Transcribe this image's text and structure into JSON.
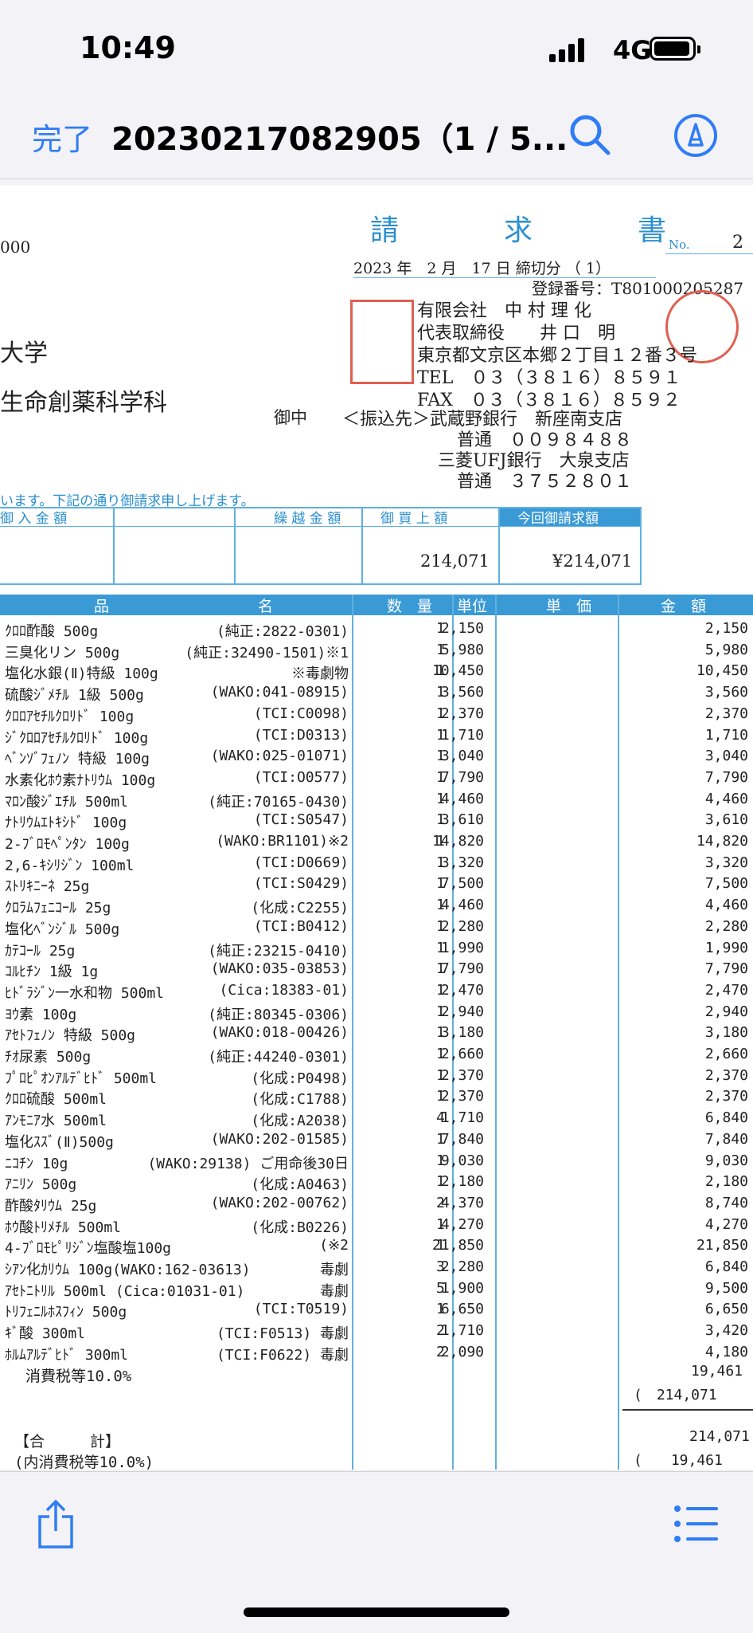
{
  "status": {
    "time": "10:49",
    "network": "4G"
  },
  "nav": {
    "done": "完了",
    "title": "20230217082905（1 / 5..."
  },
  "doc": {
    "title": "請　求　書",
    "no_label": "No.",
    "no_value": "2",
    "left_fragment_1": "000",
    "left_fragment_2": "大学",
    "left_fragment_3": "生命創薬科学科",
    "onchu": "御中",
    "date": "2023 年　2 月　17 日 締切分 （ 1）",
    "reg_no": "登録番号：T801000205287",
    "company": "有限会社　中 村 理 化",
    "rep": "代表取締役　　井 口　明",
    "address": "東京都文京区本郷２丁目１２番３号",
    "tel": "TEL　０３（３８１６）８５９１",
    "fax": "FAX　０３（３８１６）８５９２",
    "bank1": "＜振込先＞武蔵野銀行　新座南支店",
    "bank1_acct": "普通　００９８４８８",
    "bank2": "三菱UFJ銀行　大泉支店",
    "bank2_acct": "普通　３７５２８０１",
    "notice": "います。下記の通り御請求申し上げます。",
    "summary_headers": [
      "御 入 金 額",
      "繰 越 金 額",
      "御 買 上 額",
      "今回御請求額"
    ],
    "summary_purchase": "214,071",
    "summary_billed": "¥214,071"
  },
  "table": {
    "headers": {
      "item": "品",
      "name": "名",
      "qty": "数　量",
      "unit": "単位",
      "price": "単　価",
      "amount": "金　額"
    },
    "rows": [
      {
        "name": "ｸﾛﾛ酢酸 500g",
        "note": "(純正:2822-0301)",
        "qty": "1",
        "price": "2,150",
        "amount": "2,150"
      },
      {
        "name": "三臭化リン 500g",
        "note": "(純正:32490-1501)※1",
        "qty": "1",
        "price": "5,980",
        "amount": "5,980"
      },
      {
        "name": "塩化水銀(Ⅱ)特級 100g",
        "note": "※毒劇物",
        "qty": "1",
        "price": "10,450",
        "amount": "10,450"
      },
      {
        "name": "硫酸ｼﾞﾒﾁﾙ 1級 500g",
        "note": "(WAKO:041-08915)",
        "qty": "1",
        "price": "3,560",
        "amount": "3,560"
      },
      {
        "name": "ｸﾛﾛｱｾﾁﾙｸﾛﾘﾄﾞ 100g",
        "note": "(TCI:C0098)",
        "qty": "1",
        "price": "2,370",
        "amount": "2,370"
      },
      {
        "name": "ｼﾞｸﾛﾛｱｾﾁﾙｸﾛﾘﾄﾞ 100g",
        "note": "(TCI:D0313)",
        "qty": "1",
        "price": "1,710",
        "amount": "1,710"
      },
      {
        "name": "ﾍﾞﾝｿﾞﾌｪﾉﾝ 特級 100g",
        "note": "(WAKO:025-01071)",
        "qty": "1",
        "price": "3,040",
        "amount": "3,040"
      },
      {
        "name": "水素化ﾎｳ素ﾅﾄﾘｳﾑ 100g",
        "note": "(TCI:O0577)",
        "qty": "1",
        "price": "7,790",
        "amount": "7,790"
      },
      {
        "name": "ﾏﾛﾝ酸ｼﾞｴﾁﾙ 500ml",
        "note": "(純正:70165-0430)",
        "qty": "1",
        "price": "4,460",
        "amount": "4,460"
      },
      {
        "name": "ﾅﾄﾘｳﾑｴﾄｷｼﾄﾞ 100g",
        "note": "(TCI:S0547)",
        "qty": "1",
        "price": "3,610",
        "amount": "3,610"
      },
      {
        "name": "2-ﾌﾞﾛﾓﾍﾟﾝﾀﾝ 100g",
        "note": "(WAKO:BR1101)※2",
        "qty": "1",
        "price": "14,820",
        "amount": "14,820"
      },
      {
        "name": "2,6-ｷｼﾘｼﾞﾝ 100ml",
        "note": "(TCI:D0669)",
        "qty": "1",
        "price": "3,320",
        "amount": "3,320"
      },
      {
        "name": "ｽﾄﾘｷﾆｰﾈ 25g",
        "note": "(TCI:S0429)",
        "qty": "1",
        "price": "7,500",
        "amount": "7,500"
      },
      {
        "name": "ｸﾛﾗﾑﾌｪﾆｺｰﾙ 25g",
        "note": "(化成:C2255)",
        "qty": "1",
        "price": "4,460",
        "amount": "4,460"
      },
      {
        "name": "塩化ﾍﾞﾝｼﾞﾙ 500g",
        "note": "(TCI:B0412)",
        "qty": "1",
        "price": "2,280",
        "amount": "2,280"
      },
      {
        "name": "ｶﾃｺｰﾙ 25g",
        "note": "(純正:23215-0410)",
        "qty": "1",
        "price": "1,990",
        "amount": "1,990"
      },
      {
        "name": "ｺﾙﾋﾁﾝ 1級 1g",
        "note": "(WAKO:035-03853)",
        "qty": "1",
        "price": "7,790",
        "amount": "7,790"
      },
      {
        "name": "ﾋﾄﾞﾗｼﾞﾝ一水和物 500ml",
        "note": "(Cica:18383-01)",
        "qty": "1",
        "price": "2,470",
        "amount": "2,470"
      },
      {
        "name": "ﾖｳ素 100g",
        "note": "(純正:80345-0306)",
        "qty": "1",
        "price": "2,940",
        "amount": "2,940"
      },
      {
        "name": "ｱｾﾄﾌｪﾉﾝ 特級 500g",
        "note": "(WAKO:018-00426)",
        "qty": "1",
        "price": "3,180",
        "amount": "3,180"
      },
      {
        "name": "ﾁｵ尿素 500g",
        "note": "(純正:44240-0301)",
        "qty": "1",
        "price": "2,660",
        "amount": "2,660"
      },
      {
        "name": "ﾌﾟﾛﾋﾟｵﾝｱﾙﾃﾞﾋﾄﾞ 500ml",
        "note": "(化成:P0498)",
        "qty": "1",
        "price": "2,370",
        "amount": "2,370"
      },
      {
        "name": "ｸﾛﾛ硫酸 500ml",
        "note": "(化成:C1788)",
        "qty": "1",
        "price": "2,370",
        "amount": "2,370"
      },
      {
        "name": "ｱﾝﾓﾆｱ水 500ml",
        "note": "(化成:A2038)",
        "qty": "4",
        "price": "1,710",
        "amount": "6,840"
      },
      {
        "name": "塩化ｽｽﾞ(Ⅱ)500g",
        "note": "(WAKO:202-01585)",
        "qty": "1",
        "price": "7,840",
        "amount": "7,840"
      },
      {
        "name": "ﾆｺﾁﾝ 10g",
        "note": "(WAKO:29138) ご用命後30日",
        "qty": "1",
        "price": "9,030",
        "amount": "9,030"
      },
      {
        "name": "ｱﾆﾘﾝ 500g",
        "note": "(化成:A0463)",
        "qty": "1",
        "price": "2,180",
        "amount": "2,180"
      },
      {
        "name": "酢酸ﾀﾘｳﾑ 25g",
        "note": "(WAKO:202-00762)",
        "qty": "2",
        "price": "4,370",
        "amount": "8,740"
      },
      {
        "name": "ﾎｳ酸ﾄﾘﾒﾁﾙ 500ml",
        "note": "(化成:B0226)",
        "qty": "1",
        "price": "4,270",
        "amount": "4,270"
      },
      {
        "name": "4-ﾌﾞﾛﾓﾋﾟﾘｼﾞﾝ塩酸塩100g",
        "note": "(※2",
        "qty": "1",
        "price": "21,850",
        "amount": "21,850"
      },
      {
        "name": "ｼｱﾝ化ｶﾘｳﾑ 100g(WAKO:162-03613)",
        "note": "毒劇",
        "qty": "3",
        "price": "2,280",
        "amount": "6,840"
      },
      {
        "name": "ｱｾﾄﾆﾄﾘﾙ 500ml (Cica:01031-01)",
        "note": "毒劇",
        "qty": "5",
        "price": "1,900",
        "amount": "9,500"
      },
      {
        "name": "ﾄﾘﾌｪﾆﾙﾎｽﾌｨﾝ 500g",
        "note": "(TCI:T0519)",
        "qty": "1",
        "price": "6,650",
        "amount": "6,650"
      },
      {
        "name": "ｷﾞ酸 300ml",
        "note": "(TCI:F0513) 毒劇",
        "qty": "2",
        "price": "1,710",
        "amount": "3,420"
      },
      {
        "name": "ﾎﾙﾑｱﾙﾃﾞﾋﾄﾞ 300ml",
        "note": "(TCI:F0622) 毒劇",
        "qty": "2",
        "price": "2,090",
        "amount": "4,180"
      }
    ],
    "tax_label": "消費税等10.0%",
    "tax_amount": "19,461",
    "subtotal_paren": "(　214,071",
    "total_label": "【合　　　計】",
    "total_inner_tax_label": "(内消費税等10.0%)",
    "total_amount": "214,071",
    "total_tax_paren": "(　　19,461"
  }
}
